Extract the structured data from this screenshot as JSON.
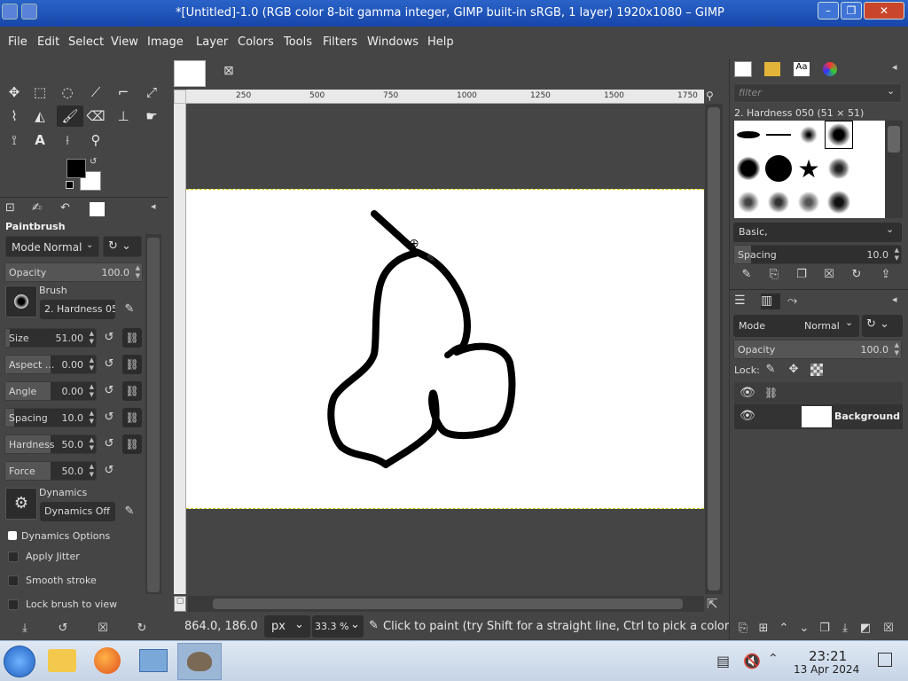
{
  "window": {
    "title": "*[Untitled]-1.0 (RGB color 8-bit gamma integer, GIMP built-in sRGB, 1 layer) 1920x1080 – GIMP",
    "minimize": "–",
    "maximize": "❐",
    "close": "✕"
  },
  "menubar": {
    "items": [
      "File",
      "Edit",
      "Select",
      "View",
      "Image",
      "Layer",
      "Colors",
      "Tools",
      "Filters",
      "Windows",
      "Help"
    ]
  },
  "toolbox": {
    "tools": [
      "move",
      "rect-select",
      "lasso",
      "fuzzy-select",
      "crop",
      "unified-transform",
      "warp",
      "bucket-fill",
      "paintbrush",
      "eraser",
      "clone",
      "smudge",
      "path",
      "text",
      "color-picker",
      "zoom"
    ],
    "fg_color": "#000000",
    "bg_color": "#ffffff"
  },
  "tool_options": {
    "title": "Paintbrush",
    "mode_label": "Mode",
    "mode_value": "Normal",
    "opacity": {
      "label": "Opacity",
      "value": "100.0",
      "level": 1.0
    },
    "brush_label": "Brush",
    "brush_name": "2. Hardness 05",
    "size": {
      "label": "Size",
      "value": "51.00",
      "level": 0.05
    },
    "aspect": {
      "label": "Aspect ...",
      "value": "0.00",
      "level": 0.5
    },
    "angle": {
      "label": "Angle",
      "value": "0.00",
      "level": 0.5
    },
    "spacing": {
      "label": "Spacing",
      "value": "10.0",
      "level": 0.1
    },
    "hardness": {
      "label": "Hardness",
      "value": "50.0",
      "level": 0.5
    },
    "force": {
      "label": "Force",
      "value": "50.0",
      "level": 0.5
    },
    "dynamics_label": "Dynamics",
    "dynamics_value": "Dynamics Off",
    "dynamics_options": "Dynamics Options",
    "apply_jitter": "Apply Jitter",
    "smooth_stroke": "Smooth stroke",
    "lock_brush": "Lock brush to view"
  },
  "canvas": {
    "ruler_ticks": [
      "250",
      "500",
      "750",
      "1000",
      "1250",
      "1500",
      "1750"
    ],
    "image_bg": "#ffffff",
    "stroke_color": "#000000"
  },
  "statusbar": {
    "coords": "864.0, 186.0",
    "unit": "px",
    "zoom": "33.3 %",
    "message": "Click to paint (try Shift for a straight line, Ctrl to pick a color)"
  },
  "brushes_panel": {
    "filter_placeholder": "filter",
    "brush_title": "2. Hardness 050 (51 × 51)",
    "preset": "Basic,",
    "spacing_label": "Spacing",
    "spacing_value": "10.0"
  },
  "layers_panel": {
    "mode_label": "Mode",
    "mode_value": "Normal",
    "opacity_label": "Opacity",
    "opacity_value": "100.0",
    "lock_label": "Lock:",
    "layer_name": "Background"
  },
  "taskbar": {
    "time": "23:21",
    "date": "13 Apr 2024"
  }
}
